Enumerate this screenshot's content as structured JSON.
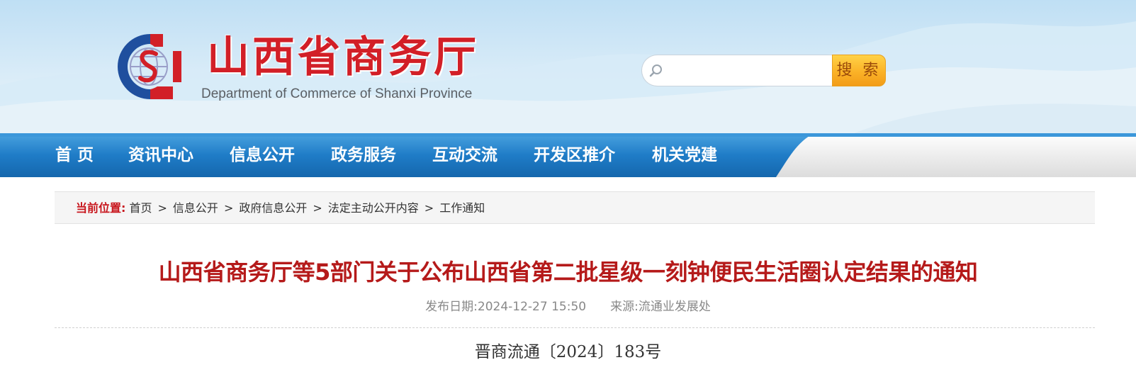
{
  "header": {
    "title": "山西省商务厅",
    "subtitle": "Department of Commerce of Shanxi Province",
    "search": {
      "placeholder": "",
      "value": "",
      "button_label": "搜 索"
    }
  },
  "nav": {
    "items": [
      {
        "label": "首  页"
      },
      {
        "label": "资讯中心"
      },
      {
        "label": "信息公开"
      },
      {
        "label": "政务服务"
      },
      {
        "label": "互动交流"
      },
      {
        "label": "开发区推介"
      },
      {
        "label": "机关党建"
      }
    ]
  },
  "breadcrumb": {
    "label": "当前位置:",
    "items": [
      "首页",
      "信息公开",
      "政府信息公开",
      "法定主动公开内容",
      "工作通知"
    ],
    "separator": ">"
  },
  "article": {
    "title": "山西省商务厅等5部门关于公布山西省第二批星级一刻钟便民生活圈认定结果的通知",
    "publish_label": "发布日期:",
    "publish_date": "2024-12-27 15:50",
    "source_label": "来源:",
    "source": "流通业发展处",
    "doc_number": "晋商流通〔2024〕183号"
  },
  "colors": {
    "brand_red": "#d21f27",
    "nav_blue": "#1f7cc7",
    "title_red": "#b51a1a",
    "breadcrumb_label": "#c8161d",
    "search_button": "#fbb227"
  },
  "icons": {
    "logo": "commerce-emblem-logo",
    "search": "search-icon"
  }
}
